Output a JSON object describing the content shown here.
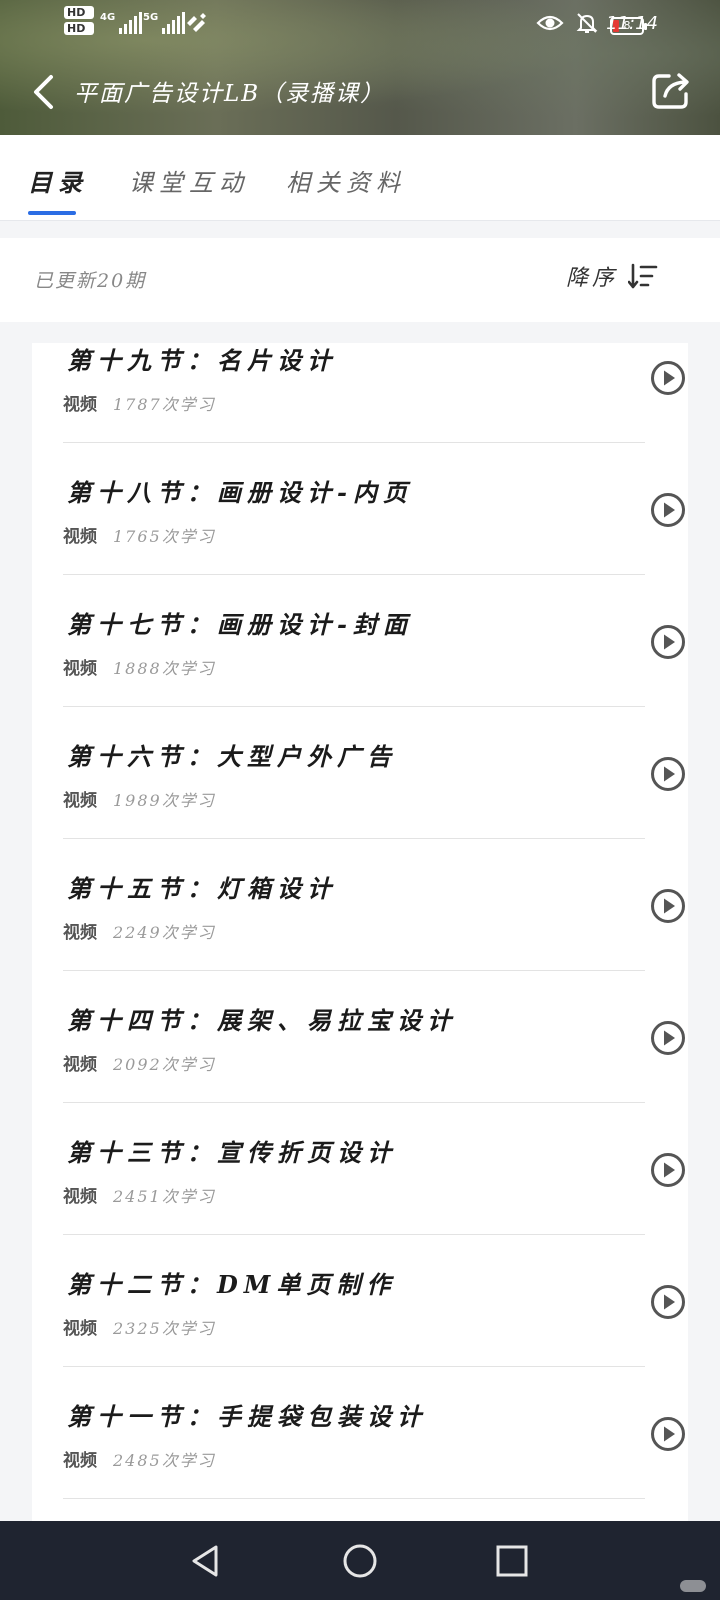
{
  "status_bar": {
    "sim1": "HD",
    "sim2": "HD",
    "net1": "4G",
    "net2": "5G",
    "battery": "8",
    "time": "11:14",
    "icons": [
      "eye-icon",
      "bell-off-icon",
      "battery-icon"
    ]
  },
  "header": {
    "title": "平面广告设计LB（录播课）",
    "back_icon": "back-arrow-icon",
    "share_icon": "share-icon"
  },
  "tabs": [
    {
      "label": "目录",
      "active": true
    },
    {
      "label": "课堂互动",
      "active": false
    },
    {
      "label": "相关资料",
      "active": false
    }
  ],
  "subheader": {
    "update_count": "已更新20期",
    "sort_label": "降序",
    "sort_icon": "sort-descending-icon"
  },
  "lessons": [
    {
      "title": "第十九节：名片设计",
      "type": "视频",
      "views": "1787次学习"
    },
    {
      "title": "第十八节：画册设计-内页",
      "type": "视频",
      "views": "1765次学习"
    },
    {
      "title": "第十七节：画册设计-封面",
      "type": "视频",
      "views": "1888次学习"
    },
    {
      "title": "第十六节：大型户外广告",
      "type": "视频",
      "views": "1989次学习"
    },
    {
      "title": "第十五节：灯箱设计",
      "type": "视频",
      "views": "2249次学习"
    },
    {
      "title": "第十四节：展架、易拉宝设计",
      "type": "视频",
      "views": "2092次学习"
    },
    {
      "title": "第十三节：宣传折页设计",
      "type": "视频",
      "views": "2451次学习"
    },
    {
      "title": "第十二节：DM单页制作",
      "type": "视频",
      "views": "2325次学习"
    },
    {
      "title": "第十一节：手提袋包装设计",
      "type": "视频",
      "views": "2485次学习"
    }
  ],
  "nav_bar": {
    "icons": [
      "nav-back-icon",
      "nav-home-icon",
      "nav-recents-icon"
    ]
  },
  "colors": {
    "accent": "#2b6de4",
    "background": "#f4f5f7",
    "nav_bar": "#1f2430"
  }
}
